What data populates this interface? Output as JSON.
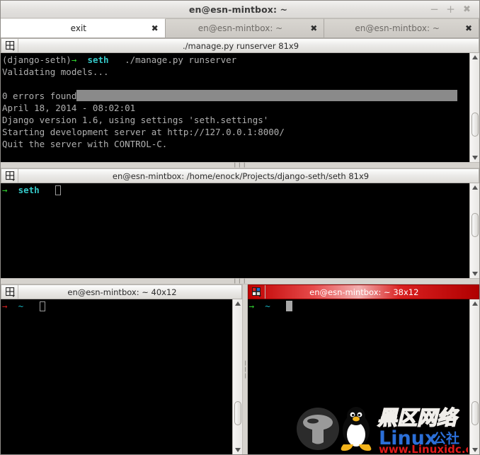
{
  "window": {
    "title": "en@esn-mintbox: ~",
    "controls": [
      {
        "name": "minimize-button",
        "glyph": "−"
      },
      {
        "name": "maximize-button",
        "glyph": "+"
      },
      {
        "name": "close-button",
        "glyph": "✖"
      }
    ]
  },
  "tabs": [
    {
      "label": "exit",
      "close": "✖",
      "active": true
    },
    {
      "label": "en@esn-mintbox: ~",
      "close": "✖",
      "active": false
    },
    {
      "label": "en@esn-mintbox: ~",
      "close": "✖",
      "active": false
    }
  ],
  "panes": {
    "runserver": {
      "title": "./manage.py runserver 81x9",
      "icon": "split-grid-icon",
      "focused": false,
      "lines": {
        "prompt_env": "(django-seth)",
        "prompt_arrow": "→",
        "prompt_user": "seth",
        "prompt_cmd": "./manage.py runserver",
        "l2": "Validating models...",
        "l3": "",
        "l4": "0 errors found",
        "l5": "April 18, 2014 - 08:02:01",
        "l6": "Django version 1.6, using settings 'seth.settings'",
        "l7": "Starting development server at http://127.0.0.1:8000/",
        "l8": "Quit the server with CONTROL-C."
      }
    },
    "project": {
      "title": "en@esn-mintbox: /home/enock/Projects/django-seth/seth 81x9",
      "icon": "split-grid-icon",
      "focused": false,
      "prompt_arrow": "→",
      "prompt_user": "seth"
    },
    "bottom_left": {
      "title": "en@esn-mintbox: ~ 40x12",
      "icon": "split-grid-icon",
      "focused": false,
      "prompt_arrow": "→",
      "prompt_path": "~"
    },
    "bottom_right": {
      "title": "en@esn-mintbox: ~ 38x12",
      "icon": "split-grid-icon-active",
      "focused": true,
      "prompt_arrow": "→",
      "prompt_path": "~"
    }
  },
  "splitter": {
    "grip": "❙❙❙"
  },
  "watermark": {
    "cn_top": "黑区网络",
    "brand": "Linux",
    "brand_cn": "公社",
    "url": "www.Linuxidc.com"
  },
  "colors": {
    "terminal_bg": "#000000",
    "terminal_fg": "#b6b6b6",
    "accent_green": "#2fd22f",
    "accent_red": "#d12020",
    "accent_cyan": "#35c8c8",
    "focus_title": "#c00000",
    "window_chrome": "#d6d3ce"
  }
}
